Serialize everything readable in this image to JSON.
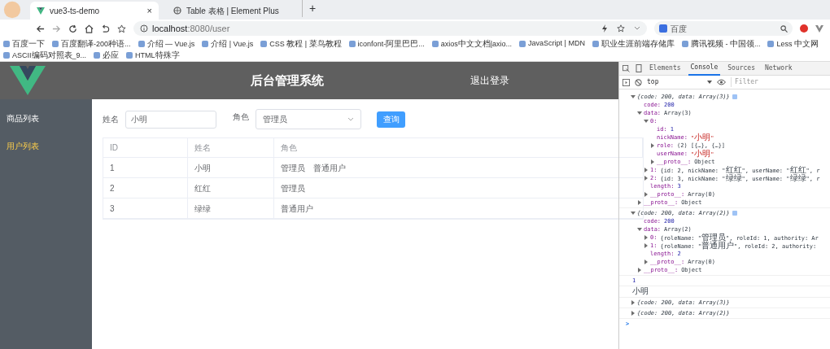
{
  "browser": {
    "tabs": [
      {
        "title": "vue3-ts-demo",
        "selected": true,
        "close": "×"
      },
      {
        "title": "Table 表格 | Element Plus",
        "selected": false
      }
    ],
    "new_tab": "+",
    "url_host": "localhost",
    "url_path": ":8080/user",
    "search": {
      "value": "百度"
    },
    "bookmarks": [
      {
        "label": "百度一下"
      },
      {
        "label": "百度翻译-200种语..."
      },
      {
        "label": "介绍 — Vue.js"
      },
      {
        "label": "介绍 | Vue.js"
      },
      {
        "label": "CSS 教程 | 菜鸟教程"
      },
      {
        "label": "iconfont-阿里巴巴..."
      },
      {
        "label": "axios中文文档|axio..."
      },
      {
        "label": "JavaScript | MDN"
      },
      {
        "label": "职业生涯前端存储库"
      },
      {
        "label": "腾讯视频 - 中国领..."
      },
      {
        "label": "Less 中文网"
      },
      {
        "label": "ASCII编码对照表_9..."
      },
      {
        "label": "必应"
      },
      {
        "label": "HTML特殊字"
      }
    ]
  },
  "app": {
    "title": "后台管理系统",
    "logout": "退出登录",
    "menu": [
      {
        "label": "商品列表",
        "selected": false
      },
      {
        "label": "用户列表",
        "selected": true
      }
    ],
    "form": {
      "name_label": "姓名",
      "name_value": "小明",
      "role_label": "角色",
      "role_value": "管理员",
      "query_button": "查询"
    },
    "table": {
      "columns": [
        "ID",
        "姓名",
        "角色"
      ],
      "rows": [
        {
          "id": "1",
          "name": "小明",
          "roles": [
            "管理员",
            "普通用户"
          ]
        },
        {
          "id": "2",
          "name": "红红",
          "roles": [
            "管理员"
          ]
        },
        {
          "id": "3",
          "name": "绿绿",
          "roles": [
            "普通用户"
          ]
        }
      ]
    }
  },
  "devtools": {
    "tabs": [
      {
        "label": "Elements",
        "selected": false
      },
      {
        "label": "Console",
        "selected": true
      },
      {
        "label": "Sources",
        "selected": false
      },
      {
        "label": "Network",
        "selected": false
      }
    ],
    "context": "top",
    "filter": {
      "placeholder": "Filter"
    },
    "console": [
      {
        "kind": "object",
        "summary": "{code: 200, data: Array(3)}",
        "expanded": true,
        "children": [
          {
            "key": "code:",
            "value": "200",
            "kind": "number"
          },
          {
            "key": "data:",
            "value": "Array(3)",
            "kind": "object",
            "expanded": true,
            "children": [
              {
                "key": "0:",
                "expanded": true,
                "children": [
                  {
                    "key": "id:",
                    "value": "1",
                    "kind": "number"
                  },
                  {
                    "key": "nickName:",
                    "value": "\"小明\"",
                    "kind": "string"
                  },
                  {
                    "key": "role:",
                    "value": "(2) [{…}, {…}]",
                    "kind": "object",
                    "expanded": false
                  },
                  {
                    "key": "userName:",
                    "value": "\"小明\"",
                    "kind": "string"
                  },
                  {
                    "key": "__proto__:",
                    "value": "Object",
                    "kind": "object",
                    "expanded": false
                  }
                ]
              },
              {
                "key": "1:",
                "value": "{id: 2, nickName: \"红红\", userName: \"红红\", r",
                "kind": "object",
                "expanded": false
              },
              {
                "key": "2:",
                "value": "{id: 3, nickName: \"绿绿\", userName: \"绿绿\", r",
                "kind": "object",
                "expanded": false
              },
              {
                "key": "length:",
                "value": "3",
                "kind": "number"
              },
              {
                "key": "__proto__:",
                "value": "Array(0)",
                "kind": "object",
                "expanded": false
              }
            ]
          },
          {
            "key": "__proto__:",
            "value": "Object",
            "kind": "object",
            "expanded": false
          }
        ]
      },
      {
        "kind": "object",
        "summary": "{code: 200, data: Array(2)}",
        "expanded": true,
        "children": [
          {
            "key": "code:",
            "value": "200",
            "kind": "number"
          },
          {
            "key": "data:",
            "value": "Array(2)",
            "kind": "object",
            "expanded": true,
            "children": [
              {
                "key": "0:",
                "value": "{roleName: \"管理员\", roleId: 1, authority: Ar",
                "kind": "object",
                "expanded": false
              },
              {
                "key": "1:",
                "value": "{roleName: \"普通用户\", roleId: 2, authority:",
                "kind": "object",
                "expanded": false
              },
              {
                "key": "length:",
                "value": "2",
                "kind": "number"
              },
              {
                "key": "__proto__:",
                "value": "Array(0)",
                "kind": "object",
                "expanded": false
              }
            ]
          },
          {
            "key": "__proto__:",
            "value": "Object",
            "kind": "object",
            "expanded": false
          }
        ]
      },
      {
        "kind": "number",
        "text": "1"
      },
      {
        "kind": "text",
        "text": "小明"
      },
      {
        "kind": "object",
        "summary": "{code: 200, data: Array(3)}",
        "expanded": false
      },
      {
        "kind": "object",
        "summary": "{code: 200, data: Array(2)}",
        "expanded": false
      },
      {
        "kind": "prompt",
        "text": ">"
      }
    ]
  }
}
